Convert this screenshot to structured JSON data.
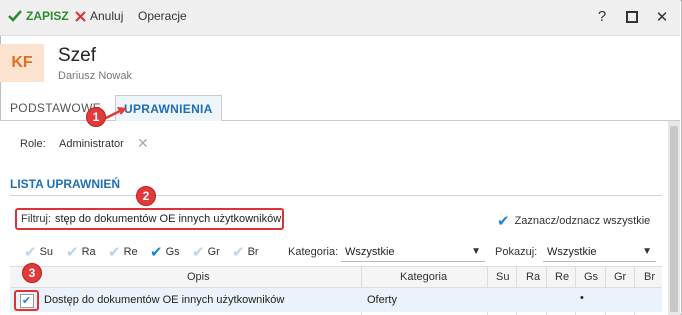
{
  "toolbar": {
    "save_label": "ZAPISZ",
    "cancel_label": "Anuluj",
    "operations_label": "Operacje",
    "help_label": "?",
    "close_label": "✕"
  },
  "header": {
    "initials": "KF",
    "title": "Szef",
    "subtitle": "Dariusz Nowak"
  },
  "tabs": [
    {
      "label": "PODSTAWOWE"
    },
    {
      "label": "UPRAWNIENIA"
    }
  ],
  "roles": {
    "label": "Role:",
    "value": "Administrator",
    "clear": "✕"
  },
  "section_title": "LISTA UPRAWNIEŃ",
  "filter": {
    "label": "Filtruj:",
    "value": "stęp do dokumentów OE innych użytkowników"
  },
  "select_all": {
    "label": "Zaznacz/odznacz wszystkie",
    "checked": true
  },
  "flags": [
    {
      "label": "Su",
      "checked": false
    },
    {
      "label": "Ra",
      "checked": false
    },
    {
      "label": "Re",
      "checked": false
    },
    {
      "label": "Gs",
      "checked": true
    },
    {
      "label": "Gr",
      "checked": false
    },
    {
      "label": "Br",
      "checked": false
    }
  ],
  "category_filter": {
    "label": "Kategoria:",
    "value": "Wszystkie"
  },
  "show_filter": {
    "label": "Pokazuj:",
    "value": "Wszystkie"
  },
  "grid": {
    "columns": [
      "Opis",
      "Kategoria",
      "Su",
      "Ra",
      "Re",
      "Gs",
      "Gr",
      "Br"
    ],
    "rows": [
      {
        "checked": true,
        "opis": "Dostęp do dokumentów OE innych użytkowników",
        "kategoria": "Oferty",
        "gs": "•"
      }
    ]
  },
  "annotations": [
    "1",
    "2",
    "3"
  ],
  "colors": {
    "accent": "#1f6fb2",
    "save": "#2e8b2e",
    "annotation": "#e23a3a"
  }
}
